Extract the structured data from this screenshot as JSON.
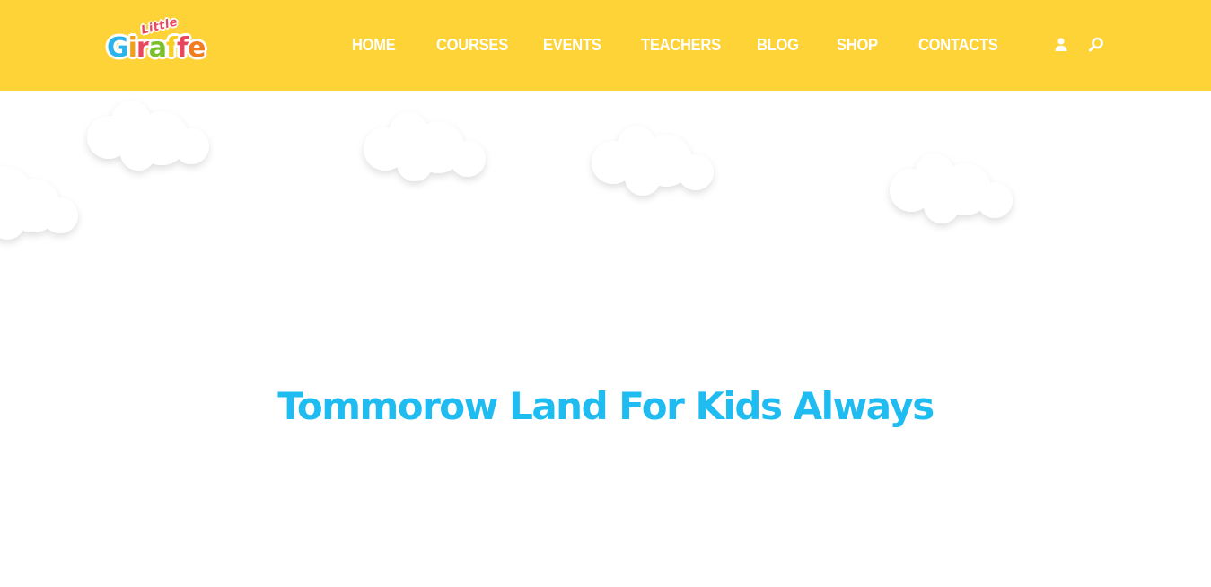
{
  "brand": {
    "logo_small": "Little",
    "logo_main": [
      "G",
      "i",
      "r",
      "a",
      "f",
      "f",
      "e"
    ]
  },
  "nav": {
    "items": [
      {
        "label": "HOME"
      },
      {
        "label": "COURSES"
      },
      {
        "label": "EVENTS"
      },
      {
        "label": "TEACHERS"
      },
      {
        "label": "BLOG"
      },
      {
        "label": "SHOP"
      },
      {
        "label": "CONTACTS"
      }
    ],
    "icons": [
      "user-icon",
      "search-icon"
    ]
  },
  "hero": {
    "headline": "Tommorow Land For Kids Always"
  },
  "colors": {
    "header_bg": "#fed337",
    "headline": "#1ebcf0",
    "nav_text": "#ffffff"
  }
}
